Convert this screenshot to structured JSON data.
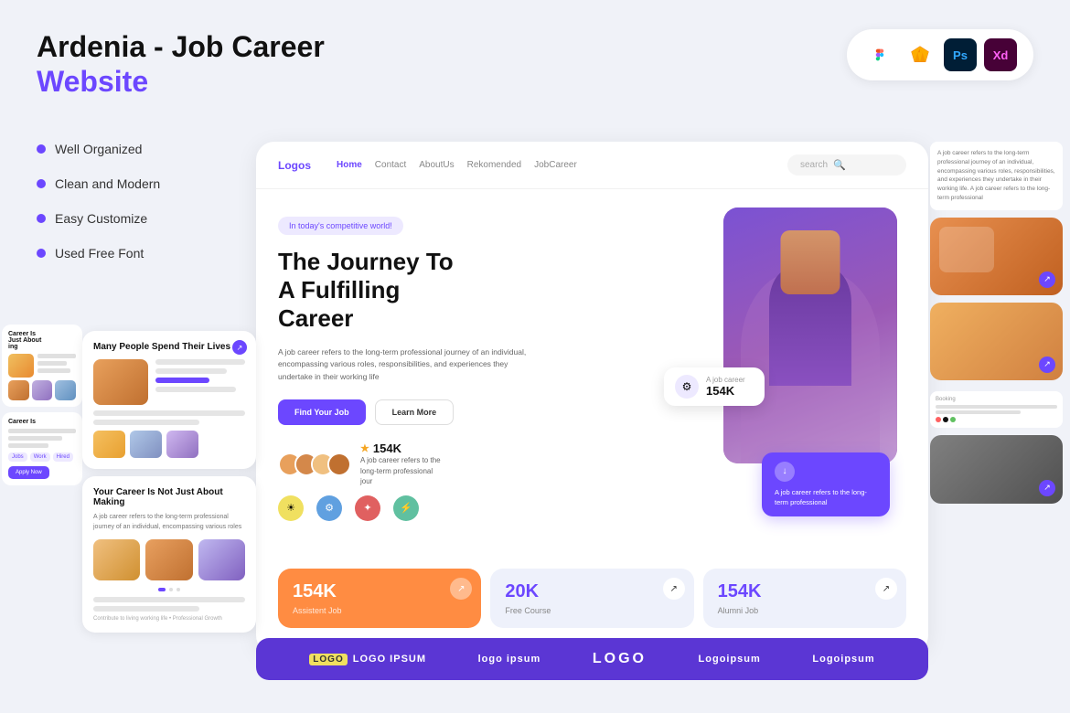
{
  "header": {
    "title": "Ardenia - Job Career",
    "subtitle": "Website",
    "tools": [
      {
        "name": "figma-icon",
        "label": "Figma",
        "bg": "#fff",
        "symbol": "🎨"
      },
      {
        "name": "sketch-icon",
        "label": "Sketch",
        "bg": "#fff",
        "symbol": "💎"
      },
      {
        "name": "photoshop-icon",
        "label": "Photoshop",
        "bg": "#001e36",
        "symbol": "Ps"
      },
      {
        "name": "xd-icon",
        "label": "Adobe XD",
        "bg": "#470137",
        "symbol": "Xd"
      }
    ]
  },
  "features": [
    {
      "label": "Well Organized"
    },
    {
      "label": "Clean and Modern"
    },
    {
      "label": "Easy Customize"
    },
    {
      "label": "Used Free Font"
    }
  ],
  "preview": {
    "nav": {
      "logo": "Logos",
      "links": [
        "Home",
        "Contact",
        "AboutUs",
        "Rekomended",
        "JobCareer"
      ],
      "active_link": "Home",
      "search_placeholder": "search"
    },
    "hero": {
      "badge": "In today's competitive world!",
      "heading_line1": "The Journey To",
      "heading_line2": "A Fulfilling",
      "heading_line3": "Career",
      "description": "A job career refers to the long-term professional journey of an individual, encompassing various roles, responsibilities, and experiences they undertake in their working life",
      "btn_primary": "Find Your Job",
      "btn_secondary": "Learn More",
      "stats_count": "154K",
      "stats_text": "A job career refers to the long-term professional jour"
    },
    "float_card_job": {
      "label": "A job career",
      "value": "154K"
    },
    "float_card_desc": {
      "text": "A job career refers to the long-term professional"
    },
    "stats_cards": [
      {
        "number": "154K",
        "label": "Assistent Job",
        "color": "orange"
      },
      {
        "number": "20K",
        "label": "Free Course",
        "color": "default"
      },
      {
        "number": "154K",
        "label": "Alumni Job",
        "color": "default"
      }
    ],
    "brand_bar": [
      {
        "label": "LOGO IPSUM"
      },
      {
        "label": "logo ipsum"
      },
      {
        "label": "LOGO"
      },
      {
        "label": "Logoipsum"
      },
      {
        "label": "Logoipsum"
      }
    ]
  },
  "left_previews": [
    {
      "title": "Many People Spend Their Lives",
      "has_image": true
    },
    {
      "title": "Your Career Is Not Just About Making",
      "has_image": true
    },
    {
      "title": "Career Is",
      "has_image": true
    }
  ],
  "accent_color": "#6c47ff",
  "orange_color": "#ff8c42"
}
